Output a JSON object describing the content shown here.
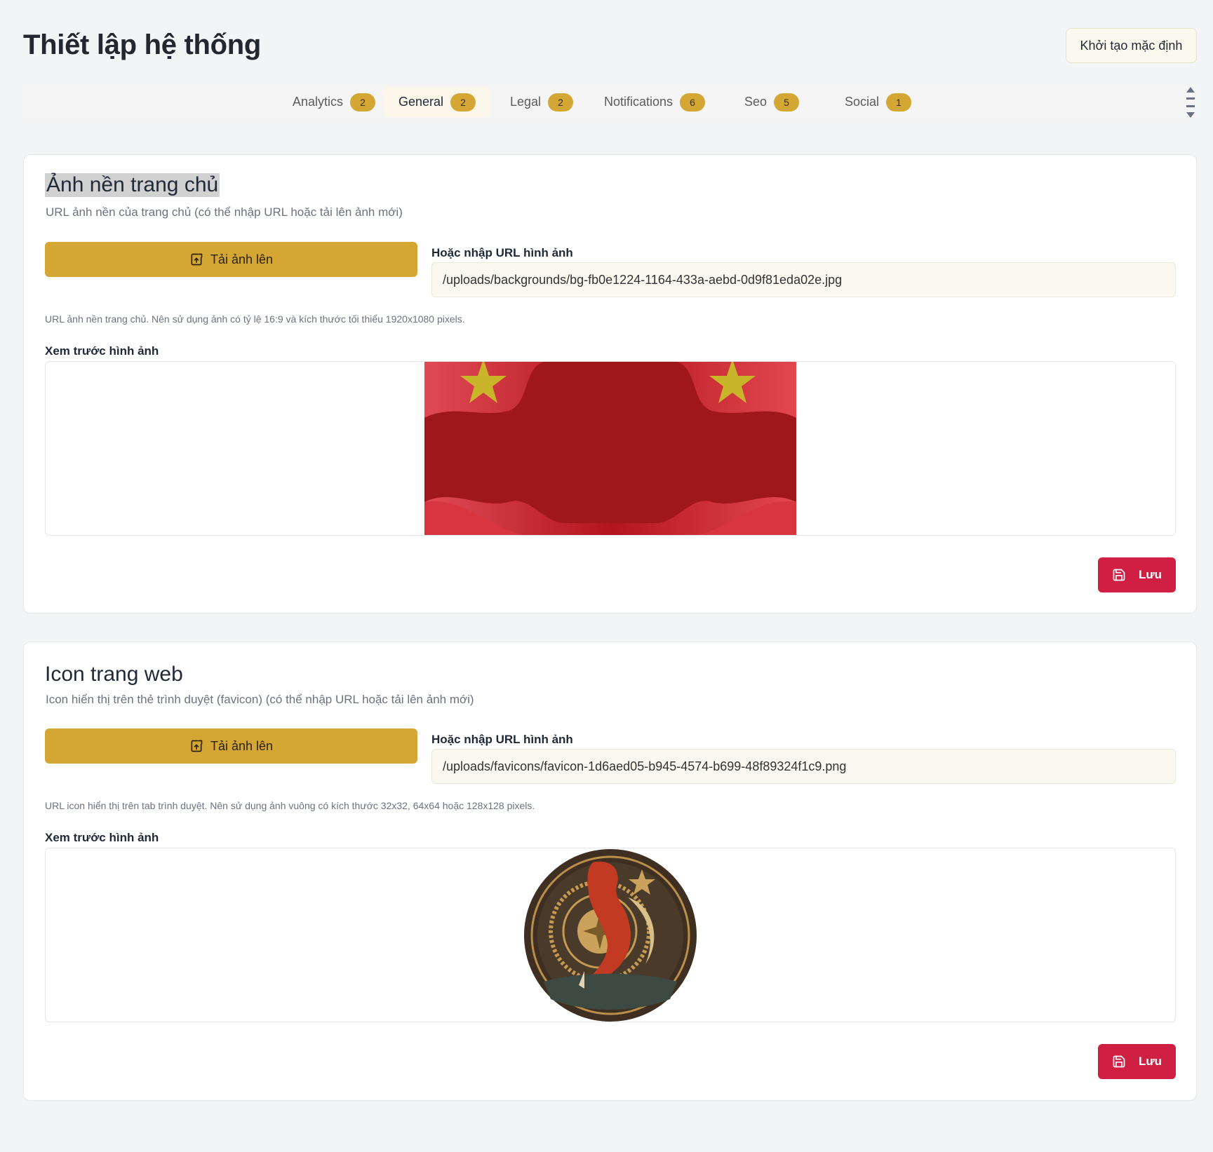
{
  "page": {
    "title": "Thiết lập hệ thống",
    "reset_label": "Khởi tạo mặc định"
  },
  "tabs": [
    {
      "label": "Analytics",
      "count": "2"
    },
    {
      "label": "General",
      "count": "2",
      "active": true
    },
    {
      "label": "Legal",
      "count": "2"
    },
    {
      "label": "Notifications",
      "count": "6"
    },
    {
      "label": "Seo",
      "count": "5"
    },
    {
      "label": "Social",
      "count": "1"
    }
  ],
  "sections": [
    {
      "title": "Ảnh nền trang chủ",
      "description": "URL ảnh nền của trang chủ (có thể nhập URL hoặc tải lên ảnh mới)",
      "upload_label": "Tải ảnh lên",
      "url_label": "Hoặc nhập URL hình ảnh",
      "url_value": "/uploads/backgrounds/bg-fb0e1224-1164-433a-aebd-0d9f81eda02e.jpg",
      "hint": "URL ảnh nền trang chủ. Nên sử dụng ảnh có tỷ lệ 16:9 và kích thước tối thiểu 1920x1080 pixels.",
      "preview_label": "Xem trước hình ảnh",
      "save_label": "Lưu"
    },
    {
      "title": "Icon trang web",
      "description": "Icon hiển thị trên thẻ trình duyệt (favicon) (có thể nhập URL hoặc tải lên ảnh mới)",
      "upload_label": "Tải ảnh lên",
      "url_label": "Hoặc nhập URL hình ảnh",
      "url_value": "/uploads/favicons/favicon-1d6aed05-b945-4574-b699-48f89324f1c9.png",
      "hint": "URL icon hiển thị trên tab trình duyệt. Nên sử dụng ảnh vuông có kích thước 32x32, 64x64 hoặc 128x128 pixels.",
      "preview_label": "Xem trước hình ảnh",
      "save_label": "Lưu"
    }
  ],
  "icons": {
    "upload": "upload-icon",
    "save": "save-icon",
    "scroll": "scroll-arrows-icon"
  },
  "colors": {
    "accent_gold": "#d4a634",
    "save_red": "#cf1f43",
    "flag_red": "#a8161b",
    "star_yellow": "#c9b52a"
  }
}
